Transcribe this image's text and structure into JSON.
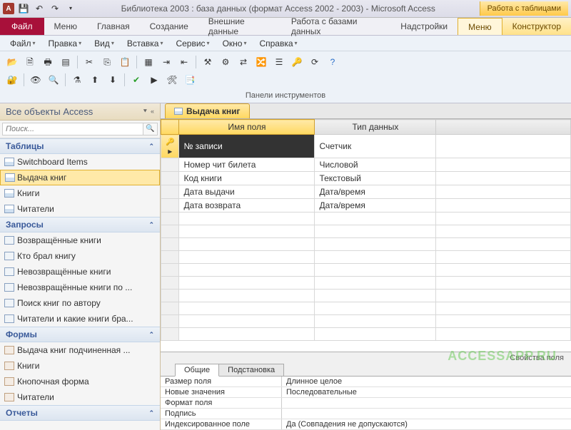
{
  "titlebar": {
    "app_letter": "A",
    "title": "Библиотека 2003 : база данных (формат Access 2002 - 2003)  -  Microsoft Access",
    "contextual_title": "Работа с таблицами"
  },
  "ribbon": {
    "file": "Файл",
    "tabs": [
      "Меню",
      "Главная",
      "Создание",
      "Внешние данные",
      "Работа с базами данных",
      "Надстройки"
    ],
    "contextual_tabs": [
      "Меню",
      "Конструктор"
    ]
  },
  "menubar": {
    "items": [
      "Файл",
      "Правка",
      "Вид",
      "Вставка",
      "Сервис",
      "Окно",
      "Справка"
    ]
  },
  "toolbar": {
    "panel_label": "Панели инструментов"
  },
  "nav": {
    "header": "Все объекты Access",
    "search_placeholder": "Поиск...",
    "groups": [
      {
        "title": "Таблицы",
        "icon": "table",
        "items": [
          "Switchboard Items",
          "Выдача книг",
          "Книги",
          "Читатели"
        ],
        "selected": 1
      },
      {
        "title": "Запросы",
        "icon": "query",
        "items": [
          "Возвращённые книги",
          "Кто брал книгу",
          "Невозвращённые книги",
          "Невозвращённые книги по ...",
          "Поиск книг по автору",
          "Читатели и какие книги бра..."
        ]
      },
      {
        "title": "Формы",
        "icon": "form",
        "items": [
          "Выдача книг подчиненная ...",
          "Книги",
          "Кнопочная форма",
          "Читатели"
        ]
      },
      {
        "title": "Отчеты",
        "icon": "query",
        "items": []
      }
    ]
  },
  "document": {
    "tab_label": "Выдача книг",
    "columns": [
      "Имя поля",
      "Тип данных"
    ],
    "rows": [
      {
        "field": "№ записи",
        "type": "Счетчик",
        "pk": true
      },
      {
        "field": "Номер чит билета",
        "type": "Числовой"
      },
      {
        "field": "Код книги",
        "type": "Текстовый"
      },
      {
        "field": "Дата выдачи",
        "type": "Дата/время"
      },
      {
        "field": "Дата возврата",
        "type": "Дата/время"
      }
    ],
    "empty_rows": 10
  },
  "properties": {
    "title": "Свойства поля",
    "tabs": [
      "Общие",
      "Подстановка"
    ],
    "rows": [
      {
        "label": "Размер поля",
        "value": "Длинное целое"
      },
      {
        "label": "Новые значения",
        "value": "Последовательные"
      },
      {
        "label": "Формат поля",
        "value": ""
      },
      {
        "label": "Подпись",
        "value": ""
      },
      {
        "label": "Индексированное поле",
        "value": "Да (Совпадения не допускаются)"
      }
    ]
  },
  "watermark": "ACCESSAPP.RU"
}
